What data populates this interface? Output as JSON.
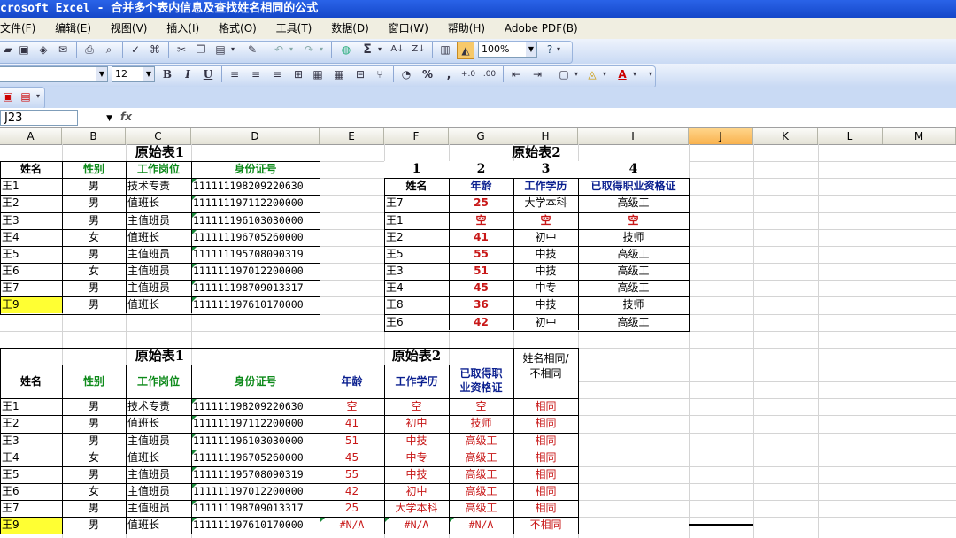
{
  "window": {
    "title": "crosoft Excel - 合并多个表内信息及查找姓名相同的公式"
  },
  "menu": [
    "文件(F)",
    "编辑(E)",
    "视图(V)",
    "插入(I)",
    "格式(O)",
    "工具(T)",
    "数据(D)",
    "窗口(W)",
    "帮助(H)",
    "Adobe PDF(B)"
  ],
  "toolbar": {
    "zoom": "100%",
    "font_size": "12"
  },
  "formula_bar": {
    "cell_ref": "J23",
    "fx": "fx"
  },
  "columns": [
    "A",
    "B",
    "C",
    "D",
    "E",
    "F",
    "G",
    "H",
    "I",
    "J",
    "K",
    "L",
    "M"
  ],
  "table1": {
    "title": "原始表1",
    "headers": [
      "姓名",
      "性别",
      "工作岗位",
      "身份证号"
    ],
    "rows": [
      [
        "王1",
        "男",
        "技术专责",
        "111111198209220630"
      ],
      [
        "王2",
        "男",
        "值班长",
        "111111197112200000"
      ],
      [
        "王3",
        "男",
        "主值班员",
        "111111196103030000"
      ],
      [
        "王4",
        "女",
        "值班长",
        "111111196705260000"
      ],
      [
        "王5",
        "男",
        "主值班员",
        "111111195708090319"
      ],
      [
        "王6",
        "女",
        "主值班员",
        "111111197012200000"
      ],
      [
        "王7",
        "男",
        "主值班员",
        "111111198709013317"
      ],
      [
        "王9",
        "男",
        "值班长",
        "111111197610170000"
      ]
    ]
  },
  "table2": {
    "title": "原始表2",
    "numbers": [
      "1",
      "2",
      "3",
      "4"
    ],
    "headers": [
      "姓名",
      "年龄",
      "工作学历",
      "已取得职业资格证"
    ],
    "rows": [
      [
        "王7",
        "25",
        "大学本科",
        "高级工"
      ],
      [
        "王1",
        "空",
        "空",
        "空"
      ],
      [
        "王2",
        "41",
        "初中",
        "技师"
      ],
      [
        "王5",
        "55",
        "中技",
        "高级工"
      ],
      [
        "王3",
        "51",
        "中技",
        "高级工"
      ],
      [
        "王4",
        "45",
        "中专",
        "高级工"
      ],
      [
        "王8",
        "36",
        "中技",
        "技师"
      ],
      [
        "王6",
        "42",
        "初中",
        "高级工"
      ]
    ]
  },
  "merged": {
    "title1": "原始表1",
    "title2": "原始表2",
    "same_header": "姓名相同/不相同",
    "headers": [
      "姓名",
      "性别",
      "工作岗位",
      "身份证号",
      "年龄",
      "工作学历",
      "已取得职业资格证"
    ],
    "rows": [
      [
        "王1",
        "男",
        "技术专责",
        "111111198209220630",
        "空",
        "空",
        "空",
        "相同"
      ],
      [
        "王2",
        "男",
        "值班长",
        "111111197112200000",
        "41",
        "初中",
        "技师",
        "相同"
      ],
      [
        "王3",
        "男",
        "主值班员",
        "111111196103030000",
        "51",
        "中技",
        "高级工",
        "相同"
      ],
      [
        "王4",
        "女",
        "值班长",
        "111111196705260000",
        "45",
        "中专",
        "高级工",
        "相同"
      ],
      [
        "王5",
        "男",
        "主值班员",
        "111111195708090319",
        "55",
        "中技",
        "高级工",
        "相同"
      ],
      [
        "王6",
        "女",
        "主值班员",
        "111111197012200000",
        "42",
        "初中",
        "高级工",
        "相同"
      ],
      [
        "王7",
        "男",
        "主值班员",
        "111111198709013317",
        "25",
        "大学本科",
        "高级工",
        "相同"
      ],
      [
        "王9",
        "男",
        "值班长",
        "111111197610170000",
        "#N/A",
        "#N/A",
        "#N/A",
        "不相同"
      ]
    ]
  },
  "colors": {
    "title_bar": "#1447c9",
    "highlight": "#ffff33",
    "green_header": "#0d8a1a",
    "navy_header": "#0a1f8f",
    "red_text": "#c81818"
  }
}
